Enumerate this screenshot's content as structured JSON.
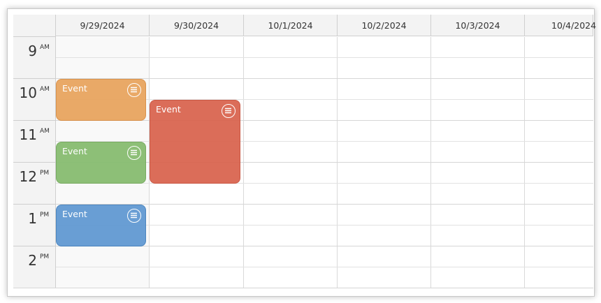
{
  "calendar": {
    "days": [
      {
        "label": "9/29/2024"
      },
      {
        "label": "9/30/2024"
      },
      {
        "label": "10/1/2024"
      },
      {
        "label": "10/2/2024"
      },
      {
        "label": "10/3/2024"
      },
      {
        "label": "10/4/2024"
      }
    ],
    "hours": [
      {
        "num": "9",
        "ampm": "AM"
      },
      {
        "num": "10",
        "ampm": "AM"
      },
      {
        "num": "11",
        "ampm": "AM"
      },
      {
        "num": "12",
        "ampm": "PM"
      },
      {
        "num": "1",
        "ampm": "PM"
      },
      {
        "num": "2",
        "ampm": "PM"
      }
    ],
    "events": [
      {
        "text": "Event",
        "color": "#e8a35b",
        "border": "#d78a3f",
        "day": "9/29/2024",
        "start": "10:00 AM",
        "end": "11:00 AM"
      },
      {
        "text": "Event",
        "color": "#d9614c",
        "border": "#c64a35",
        "day": "9/30/2024",
        "start": "10:30 AM",
        "end": "12:30 PM"
      },
      {
        "text": "Event",
        "color": "#84bb6d",
        "border": "#6ea556",
        "day": "9/29/2024",
        "start": "11:30 AM",
        "end": "12:30 PM"
      },
      {
        "text": "Event",
        "color": "#5d97d1",
        "border": "#3f7dbb",
        "day": "9/29/2024",
        "start": "1:00 PM",
        "end": "2:00 PM"
      }
    ]
  }
}
